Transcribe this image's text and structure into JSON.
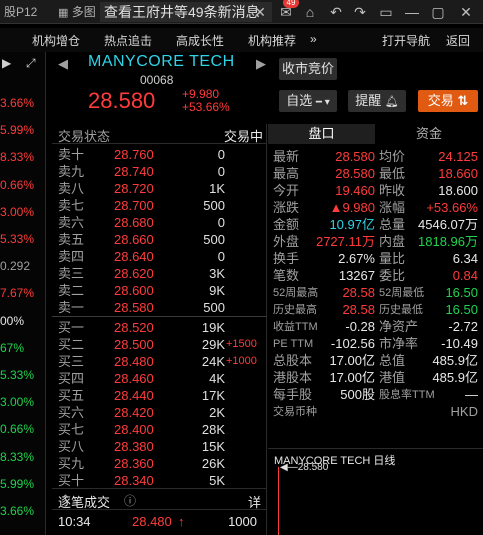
{
  "titlebar": {
    "tab1": "股P12",
    "tab2": "多图",
    "active_tab": "查看王府井等49条新消息",
    "badge": "49"
  },
  "menubar": {
    "items": [
      "机构增仓",
      "热点追击",
      "高成长性",
      "机构推荐",
      "»",
      "打开导航",
      "返回"
    ]
  },
  "left_strip": {
    "values": [
      {
        "t": "3.66%",
        "c": "red"
      },
      {
        "t": "5.99%",
        "c": "red"
      },
      {
        "t": "8.33%",
        "c": "red"
      },
      {
        "t": "0.66%",
        "c": "red"
      },
      {
        "t": "3.00%",
        "c": "red"
      },
      {
        "t": "5.33%",
        "c": "red"
      },
      {
        "t": "0.292",
        "c": "gray"
      },
      {
        "t": "7.67%",
        "c": "red"
      },
      {
        "t": "00%",
        "c": "white"
      },
      {
        "t": "67%",
        "c": "green"
      },
      {
        "t": "5.33%",
        "c": "green"
      },
      {
        "t": "3.00%",
        "c": "green"
      },
      {
        "t": "0.66%",
        "c": "green"
      },
      {
        "t": "8.33%",
        "c": "green"
      },
      {
        "t": "5.99%",
        "c": "green"
      },
      {
        "t": "3.66%",
        "c": "green"
      }
    ]
  },
  "header": {
    "name": "MANYCORE TECH",
    "code": "00068",
    "price": "28.580",
    "change": "+9.980",
    "change_pct": "+53.66%",
    "auction_btn": "收市竞价",
    "watch_btn": "自选",
    "alert_btn": "提醒",
    "trade_btn": "交易"
  },
  "book": {
    "status_label": "交易状态",
    "status_value": "交易中",
    "asks": [
      {
        "lbl": "卖十",
        "p": "28.760",
        "v": "0"
      },
      {
        "lbl": "卖九",
        "p": "28.740",
        "v": "0"
      },
      {
        "lbl": "卖八",
        "p": "28.720",
        "v": "1K"
      },
      {
        "lbl": "卖七",
        "p": "28.700",
        "v": "500"
      },
      {
        "lbl": "卖六",
        "p": "28.680",
        "v": "0"
      },
      {
        "lbl": "卖五",
        "p": "28.660",
        "v": "500"
      },
      {
        "lbl": "卖四",
        "p": "28.640",
        "v": "0"
      },
      {
        "lbl": "卖三",
        "p": "28.620",
        "v": "3K"
      },
      {
        "lbl": "卖二",
        "p": "28.600",
        "v": "9K"
      },
      {
        "lbl": "卖一",
        "p": "28.580",
        "v": "500"
      }
    ],
    "bids": [
      {
        "lbl": "买一",
        "p": "28.520",
        "v": "19K",
        "d": ""
      },
      {
        "lbl": "买二",
        "p": "28.500",
        "v": "29K",
        "d": "+1500"
      },
      {
        "lbl": "买三",
        "p": "28.480",
        "v": "24K",
        "d": "+1000"
      },
      {
        "lbl": "买四",
        "p": "28.460",
        "v": "4K",
        "d": ""
      },
      {
        "lbl": "买五",
        "p": "28.440",
        "v": "17K",
        "d": ""
      },
      {
        "lbl": "买六",
        "p": "28.420",
        "v": "2K",
        "d": ""
      },
      {
        "lbl": "买七",
        "p": "28.400",
        "v": "28K",
        "d": ""
      },
      {
        "lbl": "买八",
        "p": "28.380",
        "v": "15K",
        "d": ""
      },
      {
        "lbl": "买九",
        "p": "28.360",
        "v": "26K",
        "d": ""
      },
      {
        "lbl": "买十",
        "p": "28.340",
        "v": "5K",
        "d": ""
      }
    ]
  },
  "ticks": {
    "title": "逐笔成交",
    "detail": "详",
    "rows": [
      {
        "time": "10:34",
        "price": "28.480",
        "vol": "1000"
      }
    ]
  },
  "stats": {
    "tab_quote": "盘口",
    "tab_fund": "资金",
    "rows": [
      {
        "l1": "最新",
        "v1": "28.580",
        "c1": "red",
        "l2": "均价",
        "v2": "24.125",
        "c2": "red"
      },
      {
        "l1": "最高",
        "v1": "28.580",
        "c1": "red",
        "l2": "最低",
        "v2": "18.660",
        "c2": "red"
      },
      {
        "l1": "今开",
        "v1": "19.460",
        "c1": "red",
        "l2": "昨收",
        "v2": "18.600",
        "c2": "white"
      },
      {
        "l1": "涨跌",
        "v1": "▲9.980",
        "c1": "red",
        "l2": "涨幅",
        "v2": "+53.66%",
        "c2": "red"
      },
      {
        "l1": "金额",
        "v1": "10.97亿",
        "c1": "cyan",
        "l2": "总量",
        "v2": "4546.07万",
        "c2": "white"
      },
      {
        "l1": "外盘",
        "v1": "2727.11万",
        "c1": "red",
        "l2": "内盘",
        "v2": "1818.96万",
        "c2": "green"
      },
      {
        "l1": "换手",
        "v1": "2.67%",
        "c1": "white",
        "l2": "量比",
        "v2": "6.34",
        "c2": "white"
      },
      {
        "l1": "笔数",
        "v1": "13267",
        "c1": "white",
        "l2": "委比",
        "v2": "0.84",
        "c2": "red"
      },
      {
        "l1": "52周最高",
        "v1": "28.58",
        "c1": "red",
        "l2": "52周最低",
        "v2": "16.50",
        "c2": "green"
      },
      {
        "l1": "历史最高",
        "v1": "28.58",
        "c1": "red",
        "l2": "历史最低",
        "v2": "16.50",
        "c2": "green"
      },
      {
        "l1": "收益TTM",
        "v1": "-0.28",
        "c1": "white",
        "l2": "净资产",
        "v2": "-2.72",
        "c2": "white"
      },
      {
        "l1": "PE TTM",
        "v1": "-102.56",
        "c1": "white",
        "l2": "市净率",
        "v2": "-10.49",
        "c2": "white"
      },
      {
        "l1": "总股本",
        "v1": "17.00亿",
        "c1": "white",
        "l2": "总值",
        "v2": "485.9亿",
        "c2": "white"
      },
      {
        "l1": "港股本",
        "v1": "17.00亿",
        "c1": "white",
        "l2": "港值",
        "v2": "485.9亿",
        "c2": "white"
      },
      {
        "l1": "每手股",
        "v1": "500股",
        "c1": "white",
        "l2": "股息率TTM",
        "v2": "—",
        "c2": "white"
      },
      {
        "l1": "交易币种",
        "v1": "",
        "c1": "white",
        "l2": "",
        "v2": "HKD",
        "c2": "gray"
      }
    ]
  },
  "chart": {
    "title": "MANYCORE TECH 日线",
    "last_label": "28.580"
  },
  "colors": {
    "up": "#ff3b3b",
    "down": "#1fd34d",
    "accent": "#2fd3e8",
    "trade": "#e05a12"
  }
}
